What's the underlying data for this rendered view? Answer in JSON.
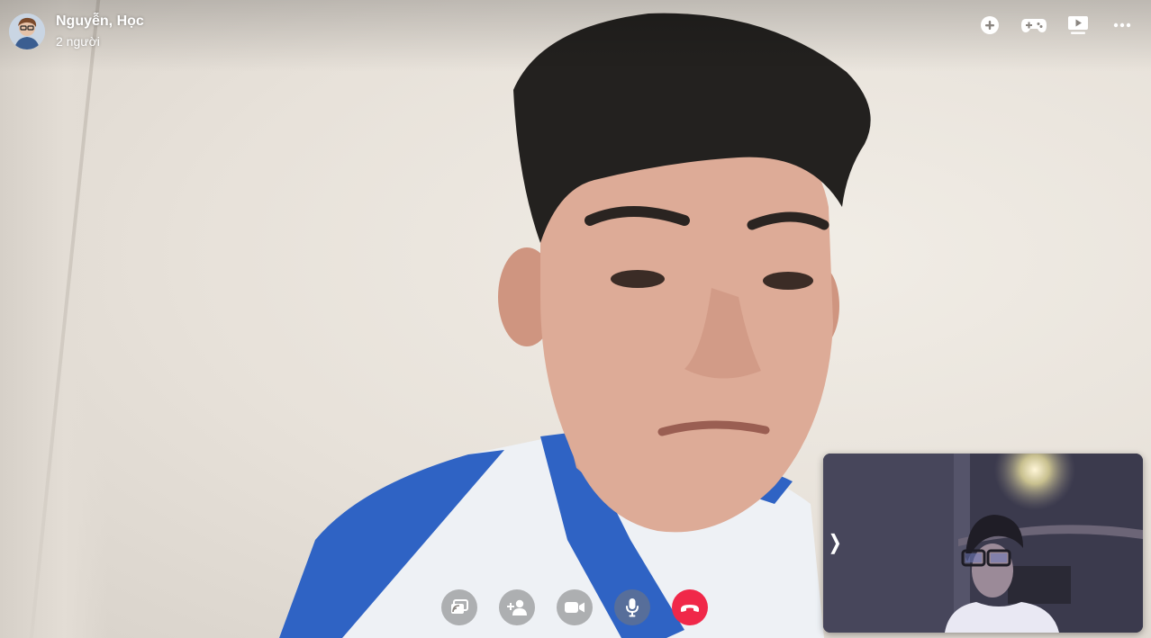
{
  "call": {
    "title": "Nguyễn, Học",
    "participants": "2 người"
  },
  "icons": {
    "top": [
      "add-circle-icon",
      "gamepad-icon",
      "video-playlist-icon",
      "more-options-icon"
    ],
    "controls": [
      "share-screen-icon",
      "add-person-icon",
      "video-camera-icon",
      "microphone-icon",
      "end-call-icon"
    ]
  },
  "self_view": {
    "collapse_glyph": "❭"
  },
  "colors": {
    "end_call": "#f02849",
    "control_bg": "rgba(120,120,120,0.55)",
    "text": "#ffffff"
  }
}
